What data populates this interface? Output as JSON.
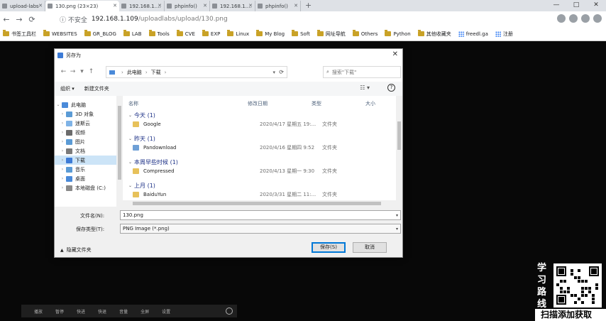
{
  "browser": {
    "tabs": [
      {
        "title": "upload-labs",
        "active": false
      },
      {
        "title": "130.png (23×23)",
        "active": true
      },
      {
        "title": "192.168.1.109/upload/...",
        "active": false
      },
      {
        "title": "phpinfo()",
        "active": false
      },
      {
        "title": "192.168.1.109/upload/...",
        "active": false
      },
      {
        "title": "phpinfo()",
        "active": false
      }
    ],
    "new_tab": "+",
    "window_controls": [
      "—",
      "□",
      "✕"
    ],
    "nav": {
      "back": "←",
      "forward": "→",
      "reload": "⟳"
    },
    "security": "ⓘ 不安全",
    "url_host": "192.168.1.109",
    "url_path": "/uploadlabs/upload/130.png",
    "bookmarks": [
      {
        "label": "书签工具栏",
        "type": "folder"
      },
      {
        "label": "WEBSITES",
        "type": "folder"
      },
      {
        "label": "GR_BLOG",
        "type": "folder"
      },
      {
        "label": "LAB",
        "type": "folder"
      },
      {
        "label": "Tools",
        "type": "folder"
      },
      {
        "label": "CVE",
        "type": "folder"
      },
      {
        "label": "EXP",
        "type": "folder"
      },
      {
        "label": "Linux",
        "type": "folder"
      },
      {
        "label": "My Blog",
        "type": "folder"
      },
      {
        "label": "Soft",
        "type": "folder"
      },
      {
        "label": "网址导航",
        "type": "folder"
      },
      {
        "label": "Others",
        "type": "folder"
      },
      {
        "label": "Python",
        "type": "folder"
      },
      {
        "label": "其他收藏夹",
        "type": "folder"
      },
      {
        "label": "freedl.ga",
        "type": "link"
      },
      {
        "label": "注册",
        "type": "link"
      }
    ]
  },
  "dialog": {
    "title": "另存为",
    "close": "✕",
    "breadcrumb": {
      "root": "此电脑",
      "current": "下载"
    },
    "search_placeholder": "搜索\"下载\"",
    "organize": "组织 ▾",
    "new_folder": "新建文件夹",
    "help": "?",
    "tree": [
      {
        "label": "此电脑",
        "indent": 0,
        "selected": false,
        "color": "#4a8ad9"
      },
      {
        "label": "3D 对象",
        "indent": 1,
        "selected": false,
        "color": "#5b9bd5"
      },
      {
        "label": "迷斯云",
        "indent": 1,
        "selected": false,
        "color": "#7fb3e6"
      },
      {
        "label": "视频",
        "indent": 1,
        "selected": false,
        "color": "#6b6b6b"
      },
      {
        "label": "图片",
        "indent": 1,
        "selected": false,
        "color": "#5b9bd5"
      },
      {
        "label": "文档",
        "indent": 1,
        "selected": false,
        "color": "#7a7a7a"
      },
      {
        "label": "下载",
        "indent": 1,
        "selected": true,
        "color": "#3d7bd6"
      },
      {
        "label": "音乐",
        "indent": 1,
        "selected": false,
        "color": "#5b9bd5"
      },
      {
        "label": "桌面",
        "indent": 1,
        "selected": false,
        "color": "#4a8ad9"
      },
      {
        "label": "本地磁盘 (C:)",
        "indent": 1,
        "selected": false,
        "color": "#8a8a8a"
      }
    ],
    "columns": {
      "name": "名称",
      "date": "修改日期",
      "type": "类型",
      "size": "大小"
    },
    "groups": [
      {
        "label": "今天 (1)",
        "files": [
          {
            "name": "Google",
            "date": "2020/4/17 星期五 19:...",
            "type": "文件夹",
            "icon": "folder"
          }
        ]
      },
      {
        "label": "昨天 (1)",
        "files": [
          {
            "name": "Pandownload",
            "date": "2020/4/16 星期四 9:52",
            "type": "文件夹",
            "icon": "folder"
          }
        ]
      },
      {
        "label": "本周早些时候 (1)",
        "files": [
          {
            "name": "Compressed",
            "date": "2020/4/13 星期一 9:30",
            "type": "文件夹",
            "icon": "folder"
          }
        ]
      },
      {
        "label": "上月 (1)",
        "files": [
          {
            "name": "BaiduYun",
            "date": "2020/3/31 星期二 11:...",
            "type": "文件夹",
            "icon": "folder"
          }
        ]
      }
    ],
    "filename_label": "文件名(N):",
    "filename_value": "130.png",
    "filetype_label": "保存类型(T):",
    "filetype_value": "PNG Image (*.png)",
    "hide_folders": "隐藏文件夹",
    "save_button": "保存(S)",
    "cancel_button": "取消"
  },
  "overlay": {
    "side_text": [
      "学",
      "习",
      "路",
      "线"
    ],
    "bottom_text": "扫描添加获取",
    "player_controls": [
      "播放",
      "暂停",
      "快进",
      "快退",
      "音量",
      "全屏",
      "设置"
    ]
  }
}
